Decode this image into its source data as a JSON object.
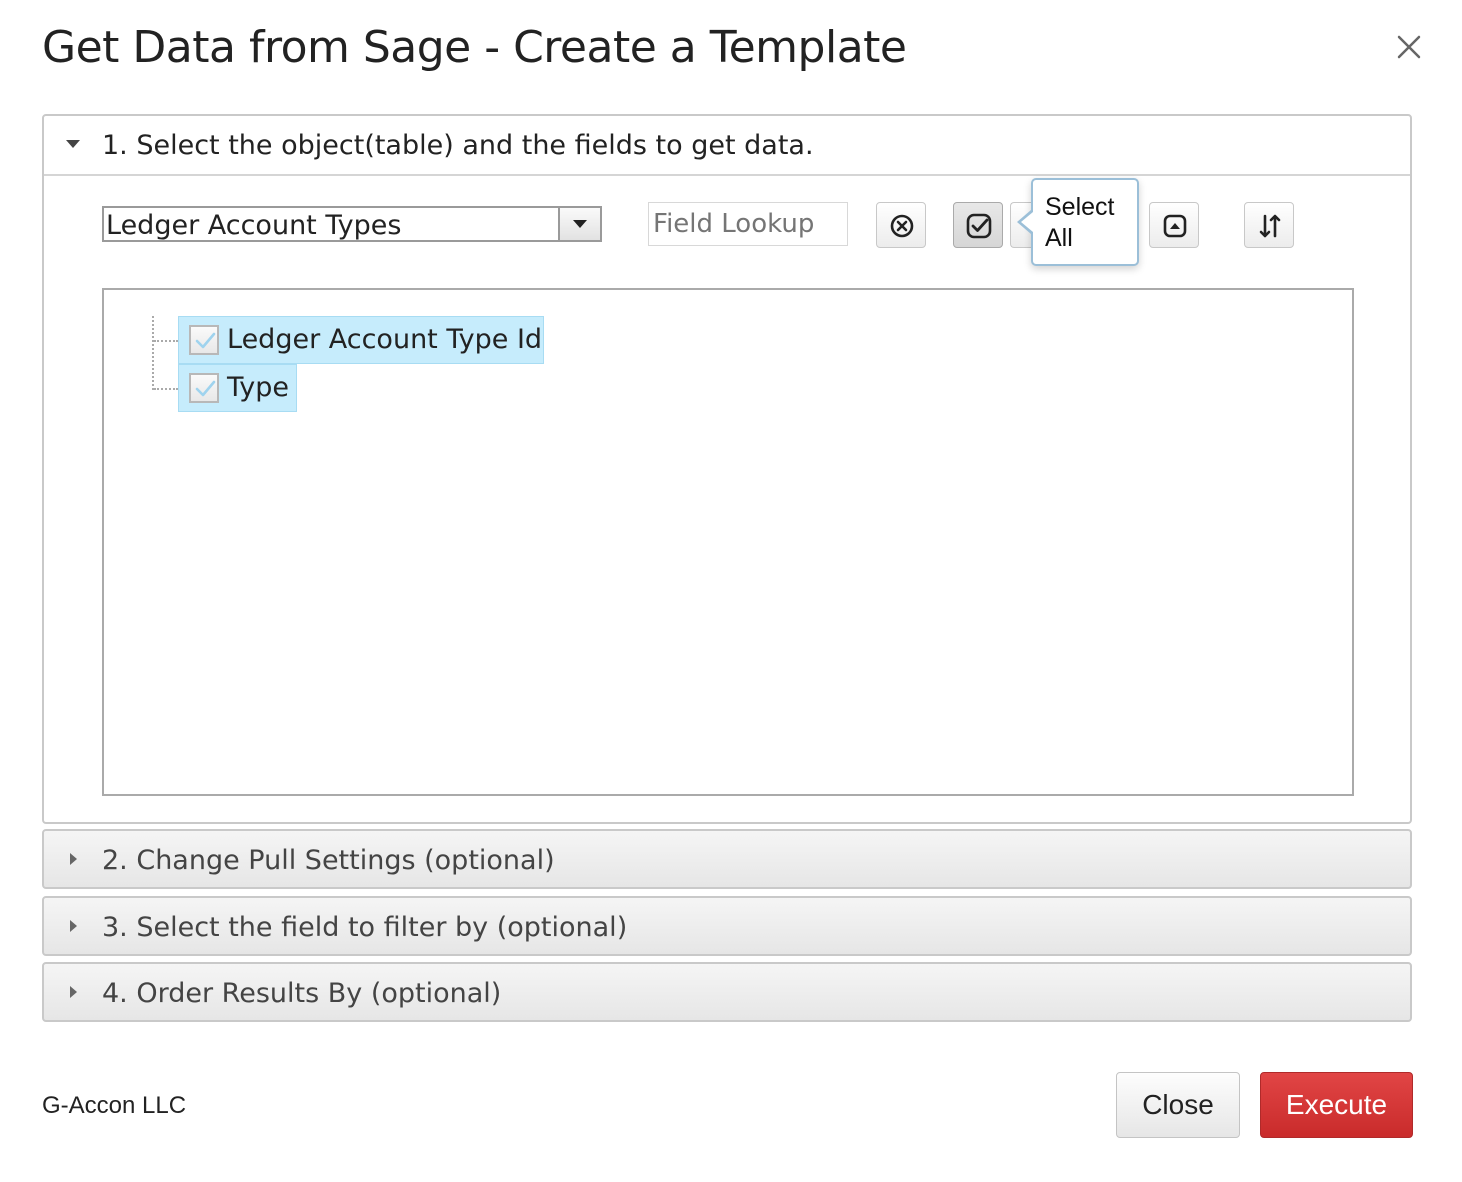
{
  "dialog": {
    "title": "Get Data from Sage - Create a Template",
    "close_icon": "close-icon"
  },
  "section1": {
    "title": "1. Select the object(table) and the fields to get data.",
    "expanded": true,
    "object_select": {
      "value": "Ledger Account Types"
    },
    "field_lookup": {
      "placeholder": "Field Lookup",
      "value": ""
    },
    "toolbar": {
      "icons": [
        "clear-icon",
        "select-all-icon",
        "collapse-icon",
        "sort-icon"
      ],
      "tooltip": "Select All"
    },
    "fields": [
      {
        "label": "Ledger Account Type Id",
        "checked": true
      },
      {
        "label": "Type",
        "checked": true
      }
    ]
  },
  "section2": {
    "title": "2. Change Pull Settings (optional)",
    "expanded": false
  },
  "section3": {
    "title": "3. Select the field to filter by (optional)",
    "expanded": false
  },
  "section4": {
    "title": "4. Order Results By (optional)",
    "expanded": false
  },
  "footer": {
    "company": "G-Accon LLC",
    "close_label": "Close",
    "execute_label": "Execute"
  },
  "colors": {
    "execute": "#d33636",
    "selected_node": "#c6ecfc",
    "tooltip_border": "#9bbfd8"
  }
}
